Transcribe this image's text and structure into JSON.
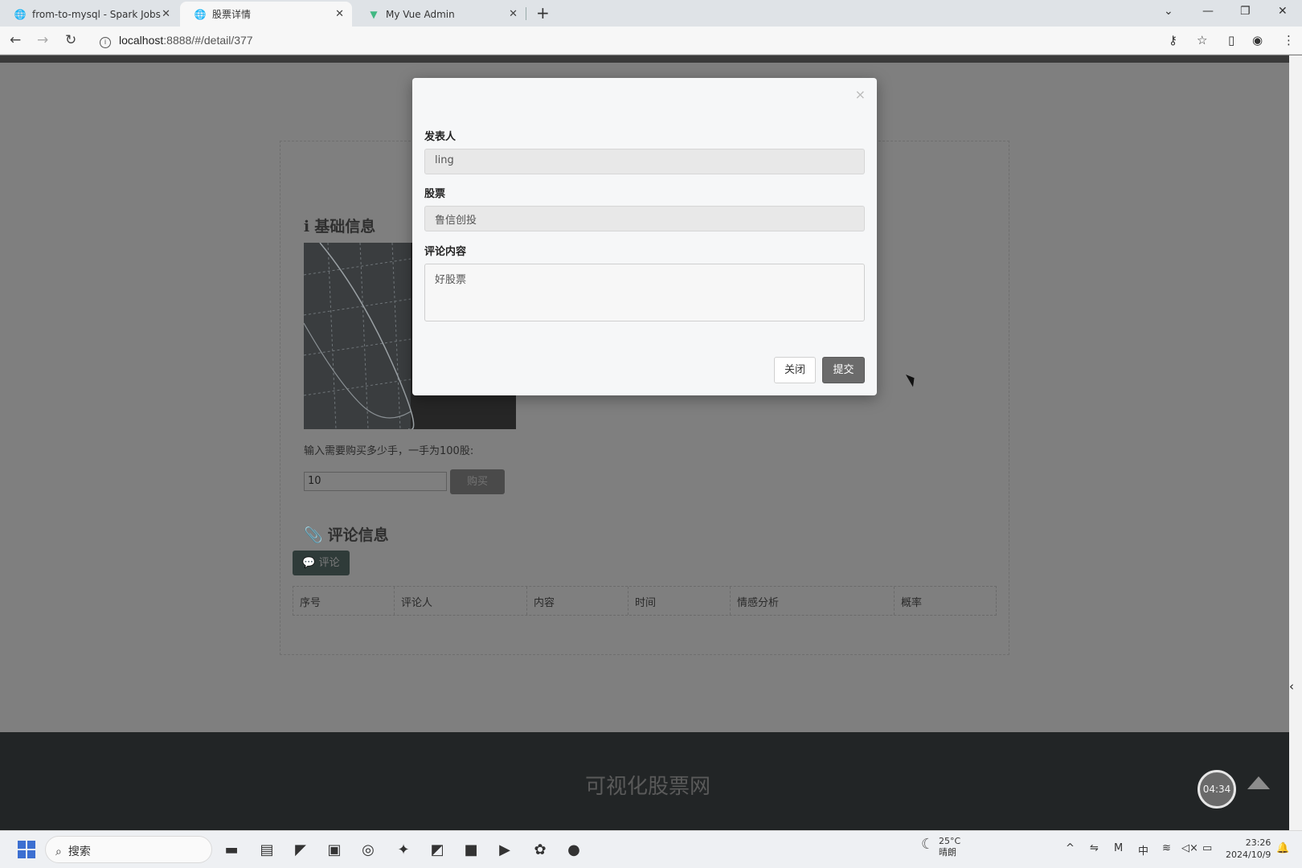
{
  "browser": {
    "tabs": [
      {
        "title": "from-to-mysql - Spark Jobs",
        "icon": "globe-icon"
      },
      {
        "title": "股票详情",
        "icon": "globe-icon"
      },
      {
        "title": "My Vue Admin",
        "icon": "vue-icon"
      }
    ],
    "url_host": "localhost",
    "url_rest": ":8888/#/detail/377"
  },
  "page": {
    "basic_info_title": "基础信息",
    "buy_label": "输入需要购买多少手，一手为100股:",
    "buy_value": "10",
    "buy_button": "购买",
    "comments_title": "评论信息",
    "comment_button": "评论",
    "table_headers": [
      "序号",
      "评论人",
      "内容",
      "时间",
      "情感分析",
      "概率"
    ],
    "footer_title": "可视化股票网",
    "timer": "04:34"
  },
  "modal": {
    "author_label": "发表人",
    "author_value": "ling",
    "stock_label": "股票",
    "stock_value": "鲁信创投",
    "content_label": "评论内容",
    "content_value": "好股票",
    "close_button": "关闭",
    "submit_button": "提交"
  },
  "taskbar": {
    "search_placeholder": "搜索",
    "weather_temp": "25°C",
    "weather_text": "晴朗",
    "ime": "中",
    "time": "23:26",
    "date": "2024/10/9"
  }
}
